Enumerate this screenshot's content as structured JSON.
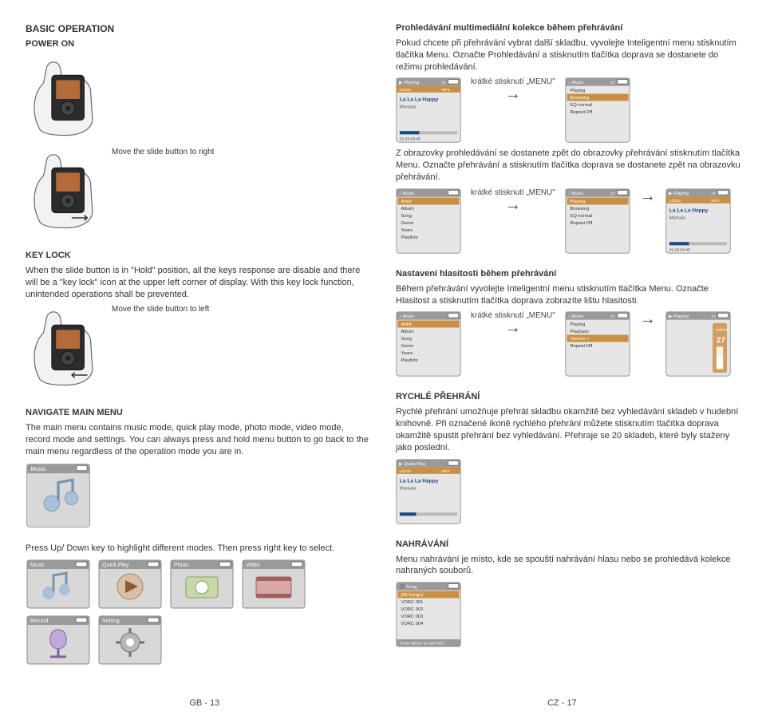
{
  "left": {
    "h1": "BASIC OPERATION",
    "powerOn": "POWER ON",
    "slideRight": "Move the slide button to right",
    "keyLockTitle": "KEY LOCK",
    "keyLockBody": "When the slide button is in \"Hold\" position, all the keys response are disable and there will be a \"key lock\" icon at the upper left corner of display. With this key lock function, unintended operations shall be prevented.",
    "slideLeft": "Move the slide button to left",
    "navTitle": "NAVIGATE MAIN MENU",
    "navBody": "The main menu contains music mode, quick play mode, photo mode, video mode, record mode and settings. You can always press and hold menu button to go back to the main menu regardless of the operation mode you are in.",
    "musicTileLabel": "Music",
    "pressUpDown": "Press Up/ Down key to highlight different modes. Then press right key to select.",
    "tiles": [
      "Music",
      "Quick Play",
      "Photo",
      "Video",
      "Record",
      "Setting"
    ],
    "footer": "GB - 13"
  },
  "right": {
    "browseTitle": "Prohledávání multimediální kolekce během přehrávání",
    "browseBody1": "Pokud chcete při přehrávání vybrat další skladbu, vyvolejte Inteligentní menu stisknutím tlačítka Menu. Označte Prohledávání a stisknutím tlačítka doprava se dostanete do režimu prohledávání.",
    "menuTap": "krátké stisknutí „MENU\"",
    "browseBack1": "Z obrazovky prohledávání se dostanete zpět do obrazovky přehrávání stisknutím tlačítka Menu. Označte přehrávání a stisknutím tlačítka doprava se dostanete zpět na obrazovku přehrávání.",
    "volumeTitle": "Nastavení hlasitosti během přehrávání",
    "volumeBody": "Během přehrávání vyvolejte Inteligentní menu stisknutím tlačítka Menu. Označte Hlasitost a stisknutím tlačítka doprava zobrazíte lištu hlasitosti.",
    "quickPlayTitle": "RYCHLÉ PŘEHRÁNÍ",
    "quickPlayBody": "Rychlé přehrání umožňuje přehrát skladbu okamžitě bez vyhledávání skladeb v hudební knihovně. Při označené ikoně rychlého přehrání můžete stisknutím tlačítka doprava okamžitě spustit přehrání bez vyhledávání. Přehraje se 20 skladeb, které byly staženy jako poslední.",
    "recordTitle": "NAHRÁVÁNÍ",
    "recordBody": "Menu nahrávání je místo, kde se spouští nahrávání hlasu nebo se prohledává kolekce nahraných souborů.",
    "player": {
      "statusBar": "▶ Playing   MP3",
      "trackNum": "14/220",
      "track": "La La La Happy",
      "artist": "Mamaia",
      "time": "01:23   03:45",
      "battery": "27"
    },
    "browseMenu": {
      "title": "Music",
      "items": [
        "Playing",
        "Browsing",
        "EQ       normal",
        "Repeat   Off"
      ]
    },
    "browseList": {
      "title": "Music",
      "items": [
        "Artist",
        "Album",
        "Song",
        "Genre",
        "Years",
        "Playlists"
      ],
      "hl": 0
    },
    "playbackMenu": {
      "title": "Music",
      "items": [
        "Playing",
        "Playback",
        "Volume   >",
        "Repeat   Off"
      ]
    },
    "volumeScreen": {
      "title": "Playing",
      "label": "volume",
      "value": "27"
    },
    "quickPlayScreen": {
      "title": "Quick Play",
      "trackNum": "14/220",
      "track": "La La La Happy",
      "artist": "Mamaia"
    },
    "songList": {
      "title": "Song",
      "items": [
        "[All Songs]",
        "VORC 001",
        "VORC 002",
        "VORC 003",
        "VORC 004"
      ],
      "footer": "Press MENU to start REC"
    },
    "footer": "CZ - 17"
  }
}
